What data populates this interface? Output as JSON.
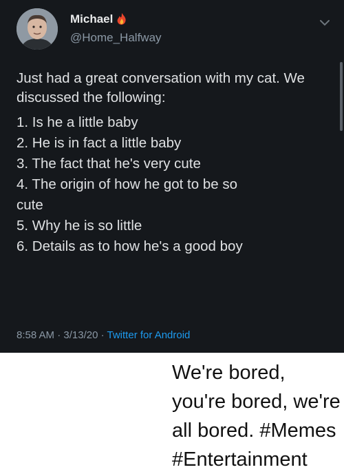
{
  "tweet": {
    "author_name": "Michael",
    "author_handle": "@Home_Halfway",
    "name_emoji_icon": "flame-icon",
    "menu_icon": "chevron-down-icon",
    "text": "Just had a great conversation with my cat. We discussed the following:",
    "list": [
      "1. Is he a little baby",
      "2. He is in fact a little baby",
      "3. The fact that he's very cute",
      "4. The origin of how he got to be so",
      "cute",
      "5. Why he is so little",
      "6. Details as to how he's a good boy"
    ],
    "time": "8:58 AM",
    "date": "3/13/20",
    "separator": "·",
    "source": "Twitter for Android",
    "colors": {
      "background": "#15181c",
      "accent": "#1d9bf0",
      "muted": "#8b98a5"
    }
  },
  "caption": "We're bored, you're bored, we're all bored. #Memes #Entertainment"
}
